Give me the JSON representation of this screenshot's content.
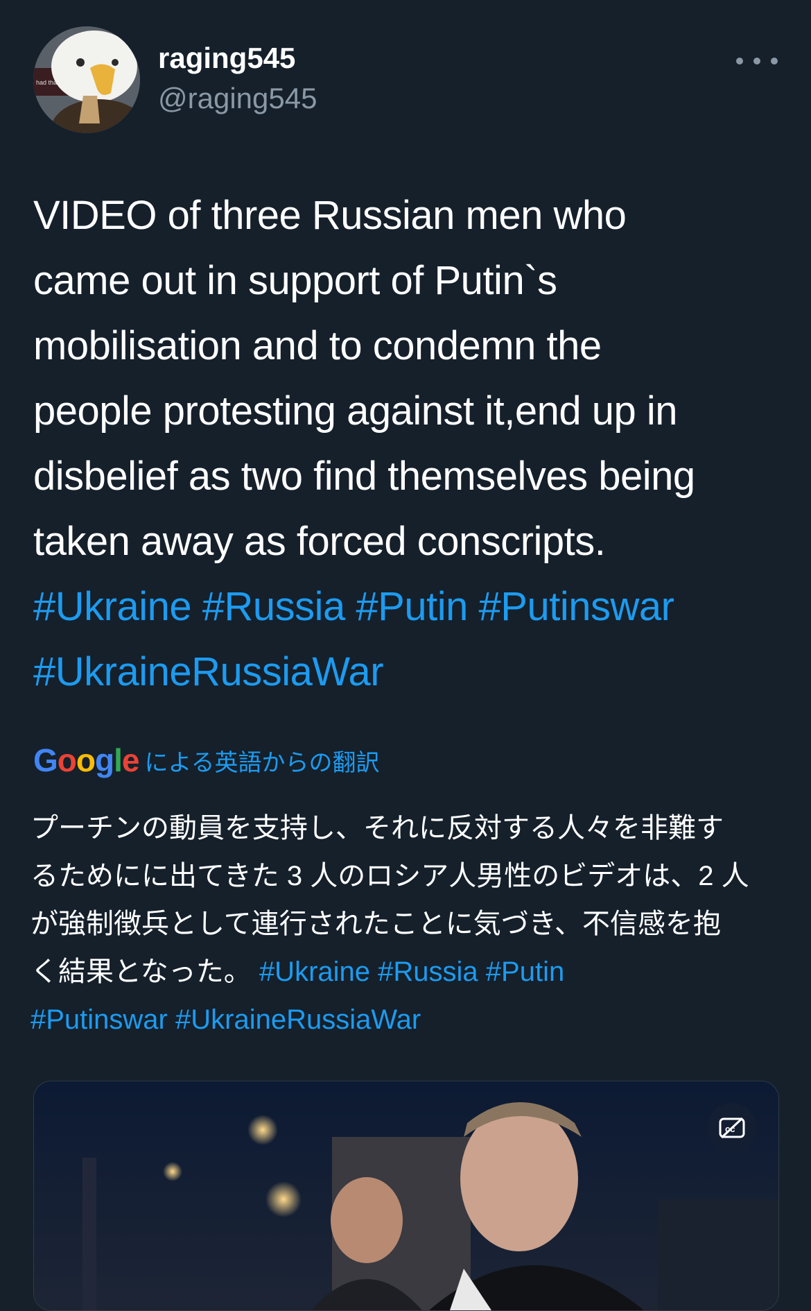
{
  "user": {
    "display_name": "raging545",
    "handle": "@raging545",
    "avatar_caption": "had that"
  },
  "tweet": {
    "lines": [
      "VIDEO of three Russian men who",
      "came out in support of Putin`s",
      "mobilisation and to condemn the",
      "people protesting against it,end up in",
      "disbelief as two find themselves being",
      "taken away as forced conscripts."
    ],
    "hashtags_line1": [
      "#Ukraine",
      "#Russia",
      "#Putin",
      "#Putinswar"
    ],
    "hashtags_line2": [
      "#UkraineRussiaWar"
    ]
  },
  "translation": {
    "brand": "Google",
    "label": "による英語からの翻訳",
    "lines": [
      "プーチンの動員を支持し、それに反対する人々を非難す",
      "るためにに出てきた 3 人のロシア人男性のビデオは、2 人",
      "が強制徴兵として連行されたことに気づき、不信感を抱",
      "く結果となった。"
    ],
    "hashtags_line4": [
      "#Ukraine",
      "#Russia",
      "#Putin"
    ],
    "hashtags_line5": [
      "#Putinswar",
      "#UkraineRussiaWar"
    ]
  },
  "icons": {
    "more": "more-horizontal-icon",
    "captions": "closed-captions-off-icon"
  },
  "colors": {
    "background": "#15202b",
    "text": "#ffffff",
    "secondary_text": "#8b98a5",
    "link": "#1d9bf0"
  }
}
